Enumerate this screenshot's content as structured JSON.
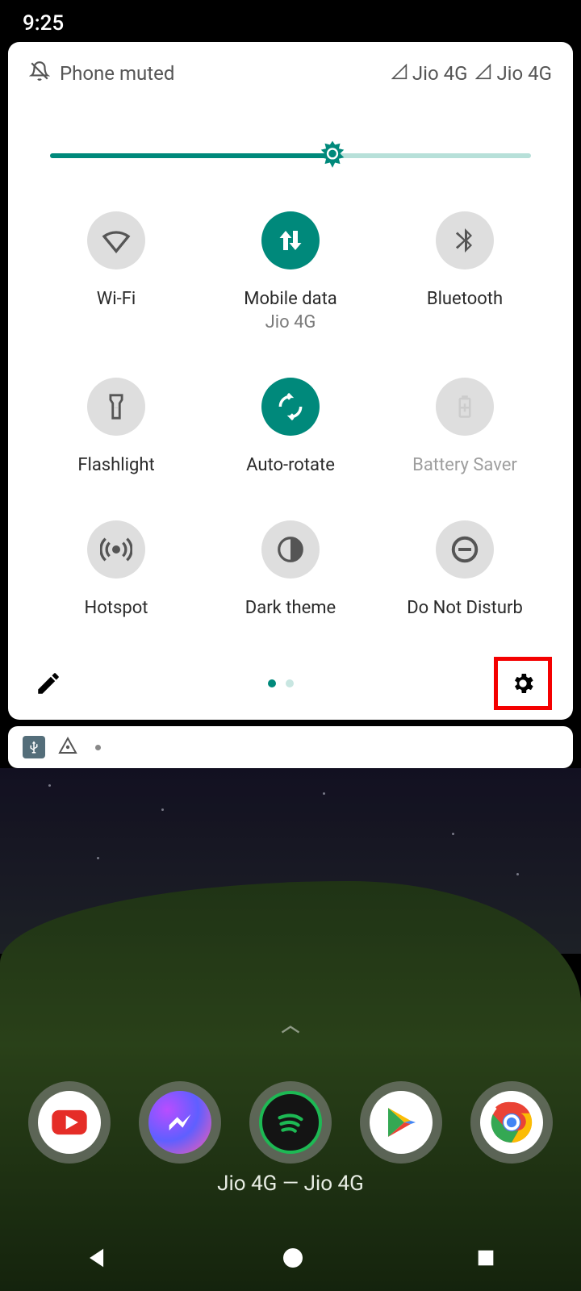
{
  "status": {
    "time": "9:25"
  },
  "header": {
    "phone_muted": "Phone muted",
    "signals": [
      {
        "label": "Jio 4G"
      },
      {
        "label": "Jio 4G"
      }
    ]
  },
  "brightness": {
    "percent": 54
  },
  "tiles": [
    {
      "id": "wifi",
      "label": "Wi-Fi",
      "sub": "",
      "state": "off"
    },
    {
      "id": "mobile-data",
      "label": "Mobile data",
      "sub": "Jio 4G",
      "state": "on"
    },
    {
      "id": "bluetooth",
      "label": "Bluetooth",
      "sub": "",
      "state": "off"
    },
    {
      "id": "flashlight",
      "label": "Flashlight",
      "sub": "",
      "state": "off"
    },
    {
      "id": "auto-rotate",
      "label": "Auto-rotate",
      "sub": "",
      "state": "on"
    },
    {
      "id": "battery-saver",
      "label": "Battery Saver",
      "sub": "",
      "state": "disabled"
    },
    {
      "id": "hotspot",
      "label": "Hotspot",
      "sub": "",
      "state": "off"
    },
    {
      "id": "dark-theme",
      "label": "Dark theme",
      "sub": "",
      "state": "off"
    },
    {
      "id": "dnd",
      "label": "Do Not Disturb",
      "sub": "",
      "state": "off"
    }
  ],
  "pager": {
    "pages": 2,
    "active": 0
  },
  "carrier_line": "Jio 4G — Jio 4G",
  "dock": [
    "YouTube",
    "Messenger",
    "Spotify",
    "Play Store",
    "Chrome"
  ]
}
